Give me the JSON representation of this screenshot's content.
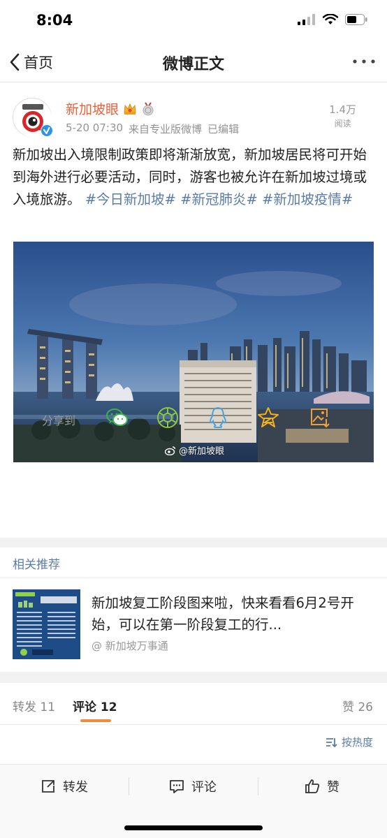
{
  "status_bar": {
    "time": "8:04"
  },
  "nav": {
    "back_label": "首页",
    "title": "微博正文"
  },
  "post": {
    "author": "新加坡眼",
    "avatar_text": "新加坡眼",
    "timestamp": "5-20 07:30",
    "source": "来自专业版微博",
    "edited": "已编辑",
    "reads_count": "1.4万",
    "reads_label": "阅读",
    "text": "新加坡出入境限制政策即将渐渐放宽，新加坡居民将可开始到海外进行必要活动，同时，游客也被允许在新加坡过境或入境旅游。",
    "hashtags": [
      "#今日新加坡#",
      "#新冠肺炎#",
      "#新加坡疫情#"
    ],
    "image_watermark": "@新加坡眼"
  },
  "share": {
    "label": "分享到",
    "targets": [
      "wechat-icon",
      "moments-icon",
      "qq-icon",
      "qzone-icon",
      "save-image-icon"
    ]
  },
  "related": {
    "title": "相关推荐",
    "headline": "新加坡复工阶段图来啦，快来看看6月2号开始，可以在第一阶段复工的行...",
    "source": "@ 新加坡万事通"
  },
  "tabs": {
    "repost_label": "转发",
    "repost_count": "11",
    "comment_label": "评论",
    "comment_count": "12",
    "like_label": "赞",
    "like_count": "26"
  },
  "sort_label": "按热度",
  "bottom_bar": {
    "repost": "转发",
    "comment": "评论",
    "like": "赞"
  },
  "colors": {
    "accent_orange": "#e8613a",
    "link_blue": "#5c7ca8",
    "tab_underline": "#f08a3c"
  }
}
